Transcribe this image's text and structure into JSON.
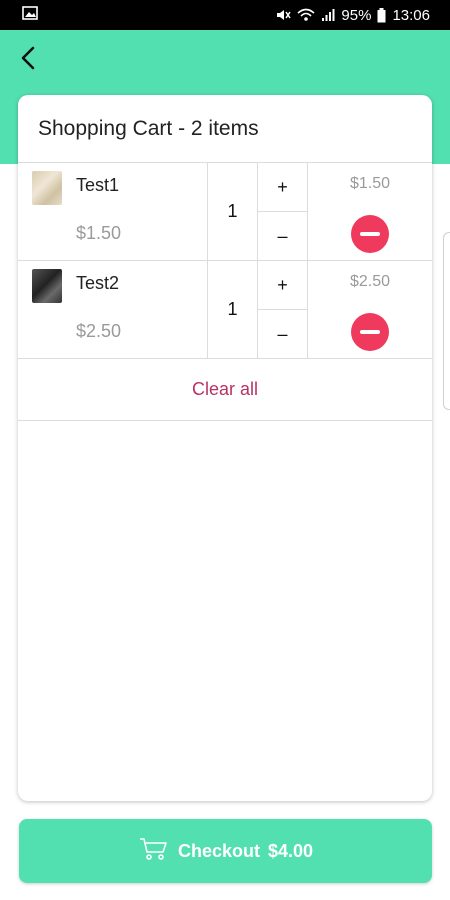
{
  "status_bar": {
    "battery_percent": "95%",
    "time": "13:06",
    "icons": [
      "gallery-icon",
      "mute-icon",
      "wifi-icon",
      "signal-icon",
      "battery-icon"
    ]
  },
  "colors": {
    "accent": "#53e0b0",
    "remove": "#ef3a5d",
    "clear_all": "#b73363",
    "muted_text": "#9a9a9a"
  },
  "header": {
    "back_icon": "back-arrow-icon"
  },
  "cart": {
    "title": "Shopping Cart - 2 items",
    "items": [
      {
        "name": "Test1",
        "unit_price": "$1.50",
        "quantity": "1",
        "plus": "+",
        "minus": "–",
        "line_total": "$1.50",
        "thumb_icon": "product-thumbnail"
      },
      {
        "name": "Test2",
        "unit_price": "$2.50",
        "quantity": "1",
        "plus": "+",
        "minus": "–",
        "line_total": "$2.50",
        "thumb_icon": "product-thumbnail"
      }
    ],
    "clear_all_label": "Clear all"
  },
  "checkout": {
    "label": "Checkout",
    "total": "$4.00",
    "icon": "cart-icon"
  }
}
